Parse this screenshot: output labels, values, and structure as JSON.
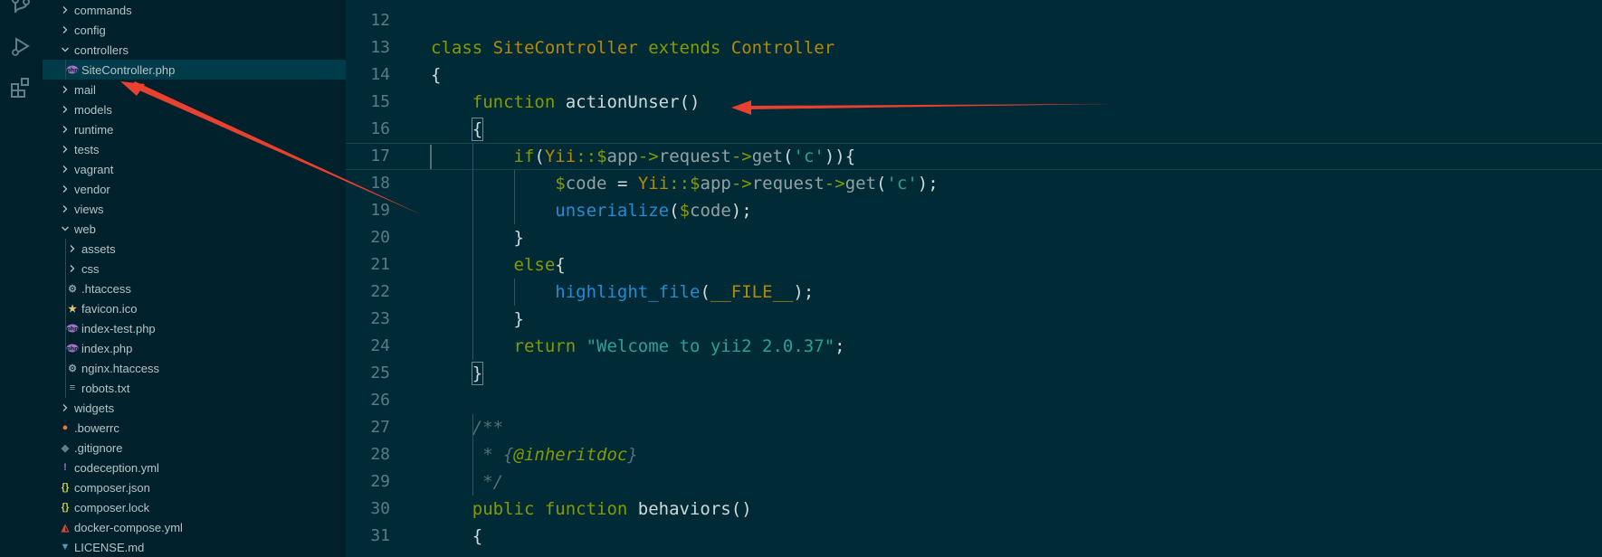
{
  "explorer": {
    "items": [
      {
        "label": "commands",
        "kind": "folder",
        "open": false,
        "depth": 0
      },
      {
        "label": "config",
        "kind": "folder",
        "open": false,
        "depth": 0
      },
      {
        "label": "controllers",
        "kind": "folder",
        "open": true,
        "depth": 0
      },
      {
        "label": "SiteController.php",
        "kind": "php",
        "depth": 1,
        "selected": true
      },
      {
        "label": "mail",
        "kind": "folder",
        "open": false,
        "depth": 0
      },
      {
        "label": "models",
        "kind": "folder",
        "open": false,
        "depth": 0
      },
      {
        "label": "runtime",
        "kind": "folder",
        "open": false,
        "depth": 0
      },
      {
        "label": "tests",
        "kind": "folder",
        "open": false,
        "depth": 0
      },
      {
        "label": "vagrant",
        "kind": "folder",
        "open": false,
        "depth": 0
      },
      {
        "label": "vendor",
        "kind": "folder",
        "open": false,
        "depth": 0
      },
      {
        "label": "views",
        "kind": "folder",
        "open": false,
        "depth": 0
      },
      {
        "label": "web",
        "kind": "folder",
        "open": true,
        "depth": 0
      },
      {
        "label": "assets",
        "kind": "folder",
        "open": false,
        "depth": 1
      },
      {
        "label": "css",
        "kind": "folder",
        "open": false,
        "depth": 1
      },
      {
        "label": ".htaccess",
        "kind": "gear",
        "depth": 1
      },
      {
        "label": "favicon.ico",
        "kind": "star",
        "depth": 1
      },
      {
        "label": "index-test.php",
        "kind": "php",
        "depth": 1
      },
      {
        "label": "index.php",
        "kind": "php",
        "depth": 1
      },
      {
        "label": "nginx.htaccess",
        "kind": "gear",
        "depth": 1
      },
      {
        "label": "robots.txt",
        "kind": "text",
        "depth": 1
      },
      {
        "label": "widgets",
        "kind": "folder",
        "open": false,
        "depth": 0
      },
      {
        "label": ".bowerrc",
        "kind": "bower",
        "depth": 0
      },
      {
        "label": ".gitignore",
        "kind": "git",
        "depth": 0
      },
      {
        "label": "codeception.yml",
        "kind": "yml",
        "depth": 0
      },
      {
        "label": "composer.json",
        "kind": "json",
        "depth": 0
      },
      {
        "label": "composer.lock",
        "kind": "json",
        "depth": 0
      },
      {
        "label": "docker-compose.yml",
        "kind": "docker",
        "depth": 0
      },
      {
        "label": "LICENSE.md",
        "kind": "md",
        "depth": 0
      }
    ]
  },
  "editor": {
    "line_numbers": [
      "12",
      "13",
      "14",
      "15",
      "16",
      "17",
      "18",
      "19",
      "20",
      "21",
      "22",
      "23",
      "24",
      "25",
      "26",
      "27",
      "28",
      "29",
      "30",
      "31"
    ],
    "lines": [
      [],
      [
        {
          "t": "class ",
          "c": "kw"
        },
        {
          "t": "SiteController ",
          "c": "ty"
        },
        {
          "t": "extends ",
          "c": "kw"
        },
        {
          "t": "Controller",
          "c": "ty"
        }
      ],
      [
        {
          "t": "{",
          "c": "def"
        }
      ],
      [
        {
          "t": "    "
        },
        {
          "t": "function ",
          "c": "kw"
        },
        {
          "t": "actionUnser",
          "c": "def"
        },
        {
          "t": "()",
          "c": "def"
        }
      ],
      [
        {
          "t": "    "
        },
        {
          "t": "{",
          "c": "def"
        }
      ],
      [
        {
          "t": "        "
        },
        {
          "t": "if",
          "c": "kw"
        },
        {
          "t": "(",
          "c": "def"
        },
        {
          "t": "Yii",
          "c": "ty"
        },
        {
          "t": "::",
          "c": "op"
        },
        {
          "t": "$",
          "c": "kw"
        },
        {
          "t": "app",
          "c": "var"
        },
        {
          "t": "->",
          "c": "op"
        },
        {
          "t": "request",
          "c": "var"
        },
        {
          "t": "->",
          "c": "op"
        },
        {
          "t": "get",
          "c": "var"
        },
        {
          "t": "(",
          "c": "def"
        },
        {
          "t": "'c'",
          "c": "str"
        },
        {
          "t": ")){",
          "c": "def"
        }
      ],
      [
        {
          "t": "            "
        },
        {
          "t": "$",
          "c": "kw"
        },
        {
          "t": "code ",
          "c": "var"
        },
        {
          "t": "= ",
          "c": "def"
        },
        {
          "t": "Yii",
          "c": "ty"
        },
        {
          "t": "::",
          "c": "op"
        },
        {
          "t": "$",
          "c": "kw"
        },
        {
          "t": "app",
          "c": "var"
        },
        {
          "t": "->",
          "c": "op"
        },
        {
          "t": "request",
          "c": "var"
        },
        {
          "t": "->",
          "c": "op"
        },
        {
          "t": "get",
          "c": "var"
        },
        {
          "t": "(",
          "c": "def"
        },
        {
          "t": "'c'",
          "c": "str"
        },
        {
          "t": ");",
          "c": "def"
        }
      ],
      [
        {
          "t": "            "
        },
        {
          "t": "unserialize",
          "c": "fn"
        },
        {
          "t": "(",
          "c": "def"
        },
        {
          "t": "$",
          "c": "kw"
        },
        {
          "t": "code",
          "c": "var"
        },
        {
          "t": ");",
          "c": "def"
        }
      ],
      [
        {
          "t": "        "
        },
        {
          "t": "}",
          "c": "def"
        }
      ],
      [
        {
          "t": "        "
        },
        {
          "t": "else",
          "c": "kw"
        },
        {
          "t": "{",
          "c": "def"
        }
      ],
      [
        {
          "t": "            "
        },
        {
          "t": "highlight_file",
          "c": "fn"
        },
        {
          "t": "(",
          "c": "def"
        },
        {
          "t": "__FILE__",
          "c": "ty"
        },
        {
          "t": ");",
          "c": "def"
        }
      ],
      [
        {
          "t": "        "
        },
        {
          "t": "}",
          "c": "def"
        }
      ],
      [
        {
          "t": "        "
        },
        {
          "t": "return ",
          "c": "kw"
        },
        {
          "t": "\"Welcome to yii2 2.0.37\"",
          "c": "str"
        },
        {
          "t": ";",
          "c": "def"
        }
      ],
      [
        {
          "t": "    "
        },
        {
          "t": "}",
          "c": "def"
        }
      ],
      [],
      [
        {
          "t": "    "
        },
        {
          "t": "/**",
          "c": "cm"
        }
      ],
      [
        {
          "t": "     "
        },
        {
          "t": "* ",
          "c": "cm"
        },
        {
          "t": "{",
          "c": "cm"
        },
        {
          "t": "@inheritdoc",
          "c": "tag"
        },
        {
          "t": "}",
          "c": "cm"
        }
      ],
      [
        {
          "t": "     "
        },
        {
          "t": "*/",
          "c": "cm"
        }
      ],
      [
        {
          "t": "    "
        },
        {
          "t": "public ",
          "c": "kw"
        },
        {
          "t": "function ",
          "c": "kw"
        },
        {
          "t": "behaviors",
          "c": "def"
        },
        {
          "t": "()",
          "c": "def"
        }
      ],
      [
        {
          "t": "    "
        },
        {
          "t": "{",
          "c": "def"
        }
      ]
    ]
  },
  "colors": {
    "bg": "#002b36",
    "sidebar_bg": "#00212b",
    "arrow": "#e8412f"
  }
}
